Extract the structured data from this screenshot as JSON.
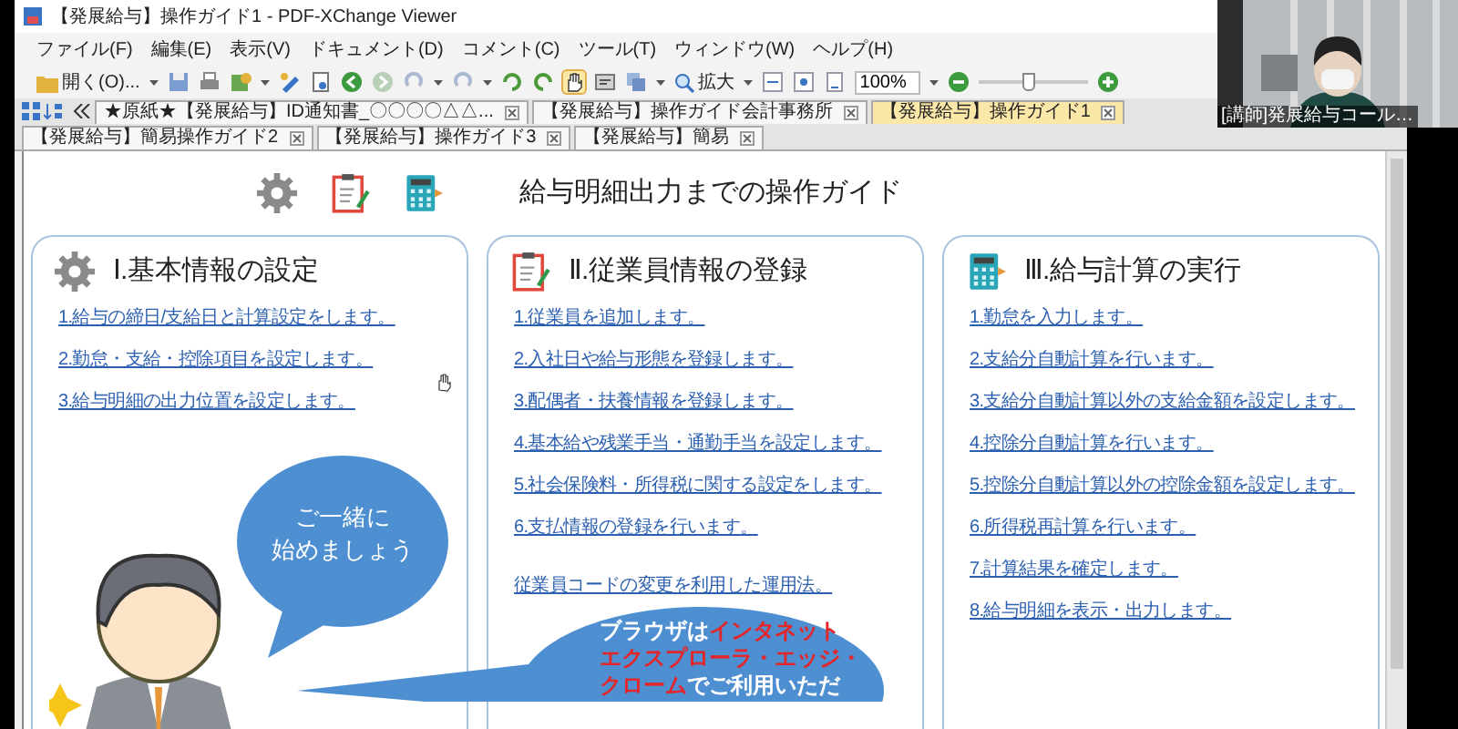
{
  "window": {
    "title": "【発展給与】操作ガイド1 - PDF-XChange Viewer"
  },
  "menu": [
    "ファイル(F)",
    "編集(E)",
    "表示(V)",
    "ドキュメント(D)",
    "コメント(C)",
    "ツール(T)",
    "ウィンドウ(W)",
    "ヘルプ(H)"
  ],
  "toolbar": {
    "open_label": "開く(O)...",
    "zoom_label": "拡大",
    "zoom_value": "100%",
    "hand_tool_selected": true
  },
  "zoom_slider": {
    "level": 0.45
  },
  "tabs": [
    {
      "label": "★原紙★【発展給与】ID通知書_〇〇〇〇△△...",
      "selected": false
    },
    {
      "label": "【発展給与】操作ガイド会計事務所",
      "selected": false
    },
    {
      "label": "【発展給与】操作ガイド1",
      "selected": true
    },
    {
      "label": "【発展給与】簡易操作ガイド2",
      "selected": false
    },
    {
      "label": "【発展給与】操作ガイド3",
      "selected": false
    },
    {
      "label": "【発展給与】簡易",
      "selected": false
    }
  ],
  "document": {
    "title": "給与明細出力までの操作ガイド",
    "sections": [
      {
        "kind": "gear",
        "heading": "Ⅰ.基本情報の設定",
        "links": [
          "1.給与の締日/支給日と計算設定をします。",
          "2.勤怠・支給・控除項目を設定します。",
          "3.給与明細の出力位置を設定します。"
        ]
      },
      {
        "kind": "clipboard",
        "heading": "Ⅱ.従業員情報の登録",
        "links": [
          "1.従業員を追加します。",
          "2.入社日や給与形態を登録します。",
          "3.配偶者・扶養情報を登録します。",
          "4.基本給や残業手当・通勤手当を設定します。",
          "5.社会保険料・所得税に関する設定をします。",
          "6.支払情報の登録を行います。"
        ],
        "extra_links": [
          "従業員コードの変更を利用した運用法。"
        ]
      },
      {
        "kind": "calculator",
        "heading": "Ⅲ.給与計算の実行",
        "links": [
          "1.勤怠を入力します。",
          "2.支給分自動計算を行います。",
          "3.支給分自動計算以外の支給金額を設定します。",
          "4.控除分自動計算を行います。",
          "5.控除分自動計算以外の控除金額を設定します。",
          "6.所得税再計算を行います。",
          "7.計算結果を確定します。",
          "8.給与明細を表示・出力します。"
        ]
      }
    ],
    "bubbles": [
      {
        "lines": [
          [
            {
              "text": "ご一緒に",
              "highlight": false
            }
          ],
          [
            {
              "text": "始めましょう",
              "highlight": false
            }
          ]
        ]
      },
      {
        "lines": [
          [
            {
              "text": "ブラウザは",
              "highlight": false
            },
            {
              "text": "インタネット",
              "highlight": true
            }
          ],
          [
            {
              "text": "エクスプローラ・エッジ・",
              "highlight": true
            }
          ],
          [
            {
              "text": "クローム",
              "highlight": true
            },
            {
              "text": "でご利用いただ",
              "highlight": false
            }
          ]
        ]
      }
    ]
  },
  "webcam": {
    "caption": "[講師]発展給与コール…"
  }
}
